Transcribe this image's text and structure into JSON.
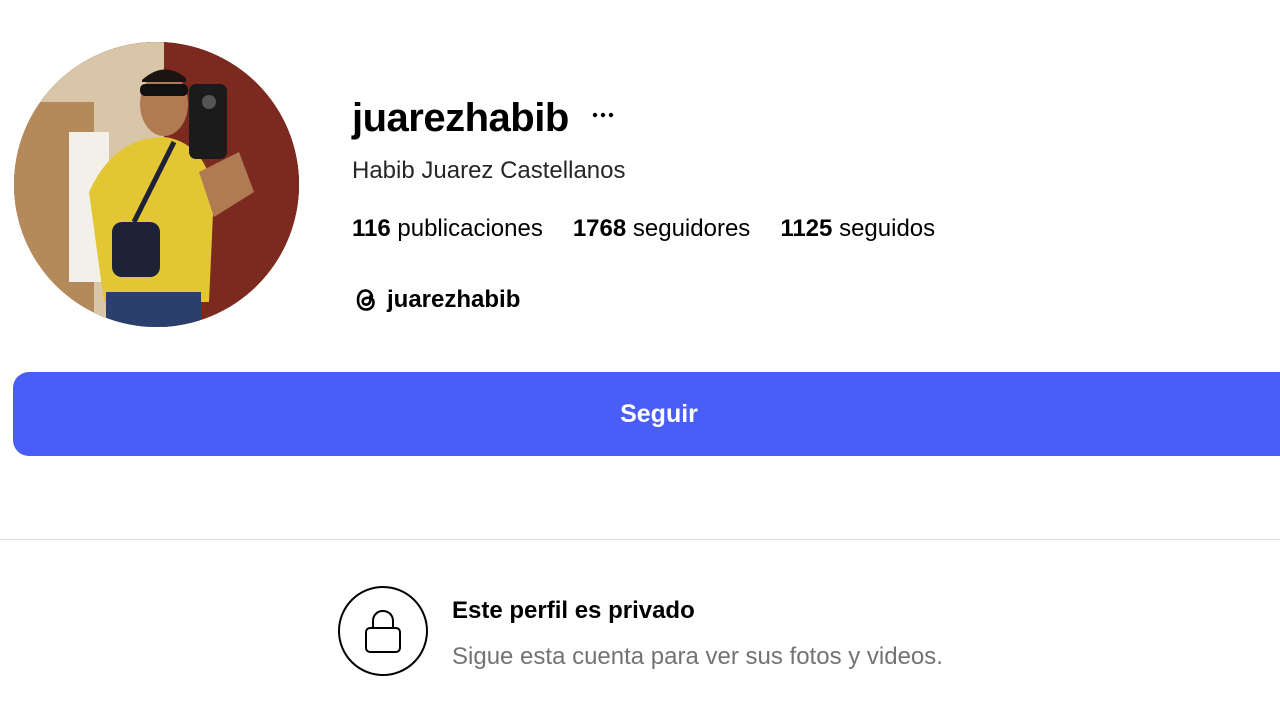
{
  "profile": {
    "username": "juarezhabib",
    "full_name": "Habib Juarez Castellanos",
    "more_icon": "more-horizontal-icon",
    "stats": {
      "posts_count": "116",
      "posts_label": "publicaciones",
      "followers_count": "1768",
      "followers_label": "seguidores",
      "following_count": "1125",
      "following_label": "seguidos"
    },
    "threads": {
      "icon": "threads-icon",
      "handle": "juarezhabib"
    }
  },
  "actions": {
    "follow_label": "Seguir",
    "follow_color": "#4a5df9"
  },
  "private_notice": {
    "icon": "lock-icon",
    "title": "Este perfil es privado",
    "subtitle": "Sigue esta cuenta para ver sus fotos y videos."
  }
}
